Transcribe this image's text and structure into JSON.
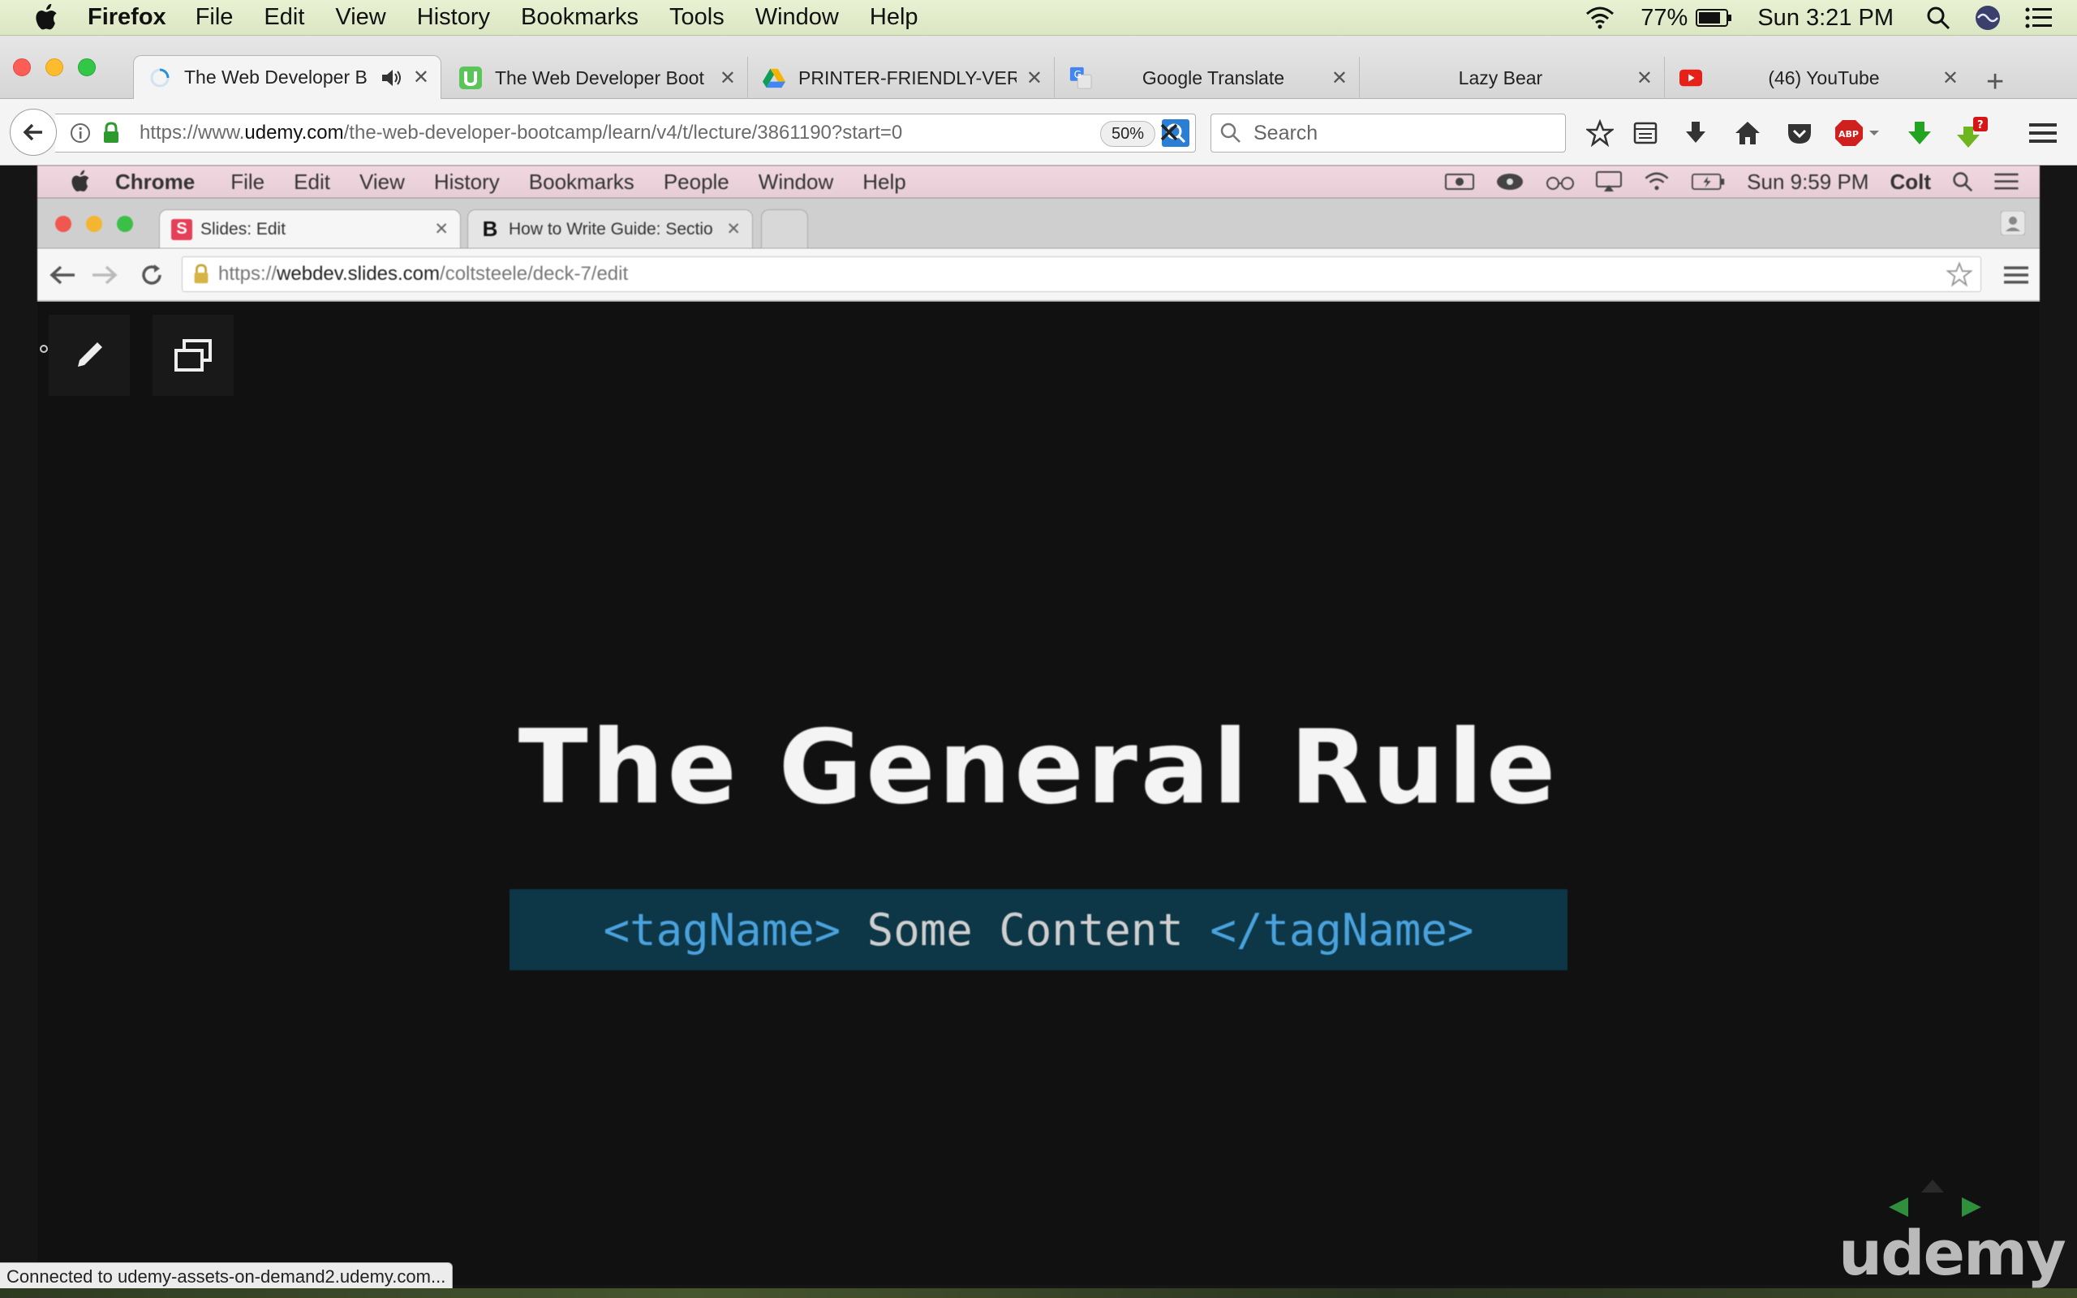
{
  "mac_menubar": {
    "app_name": "Firefox",
    "items": [
      "File",
      "Edit",
      "View",
      "History",
      "Bookmarks",
      "Tools",
      "Window",
      "Help"
    ],
    "battery": "77%",
    "clock": "Sun 3:21 PM"
  },
  "tabs": [
    {
      "title": "The Web Developer B",
      "active": true,
      "icon": "loading-spinner-icon"
    },
    {
      "title": "The Web Developer Boot",
      "icon": "udemy-favicon-icon"
    },
    {
      "title": "PRINTER-FRIENDLY-VER",
      "icon": "google-drive-icon"
    },
    {
      "title": "Google Translate",
      "icon": "google-translate-icon"
    },
    {
      "title": "Lazy Bear",
      "icon": "none"
    },
    {
      "title": "(46) YouTube",
      "icon": "youtube-icon"
    }
  ],
  "navbar": {
    "url_prefix": "https://www.",
    "url_host": "udemy.com",
    "url_path": "/the-web-developer-bootcamp/learn/v4/t/lecture/3861190?start=0",
    "zoom": "50%",
    "search_placeholder": "Search",
    "notification_count": "?"
  },
  "inner_screen": {
    "menubar": {
      "app_name": "Chrome",
      "items": [
        "File",
        "Edit",
        "View",
        "History",
        "Bookmarks",
        "People",
        "Window",
        "Help"
      ],
      "clock": "Sun 9:59 PM",
      "user": "Colt"
    },
    "tabs": [
      {
        "title": "Slides: Edit",
        "fav": "S"
      },
      {
        "title": "How to Write Guide: Sectio",
        "fav": "B"
      }
    ],
    "url_prefix": "https://",
    "url_host": "webdev.slides.com",
    "url_path": "/coltsteele/deck-7/edit"
  },
  "slide": {
    "title": "The General Rule",
    "code_open": "<tagName>",
    "code_content": " Some Content ",
    "code_close": "</tagName>"
  },
  "watermark": "udemy",
  "status_text": "Connected to udemy-assets-on-demand2.udemy.com...",
  "colors": {
    "slide_bg": "#111112",
    "code_bg": "#0d3747",
    "code_tag": "#4aa2dd",
    "udemy_nav_green": "#2f8f3a"
  }
}
